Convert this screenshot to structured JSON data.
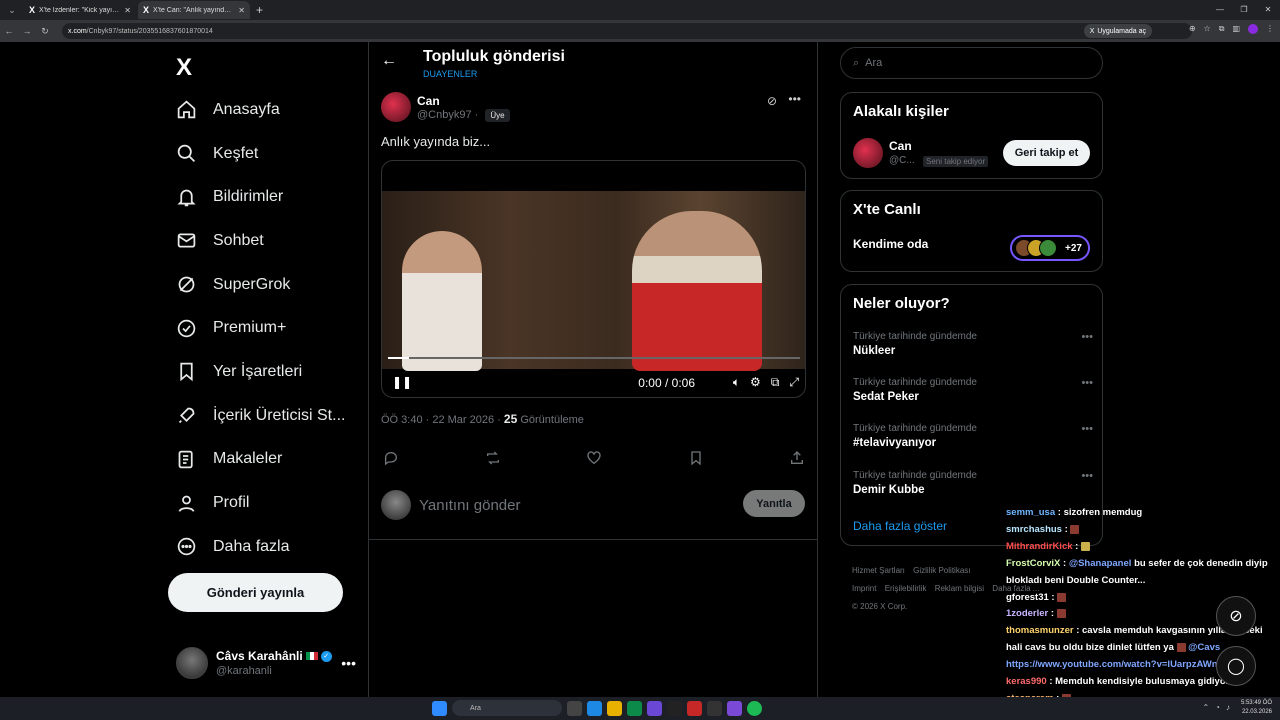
{
  "browser": {
    "tabs": [
      {
        "title": "X'te İzdenler: \"Kick yayıncısı cavs...",
        "active": false
      },
      {
        "title": "X'te Can: \"Anlık yayında biz...\"",
        "active": true
      }
    ],
    "url_domain": "x.com",
    "url_path": "/Cnbyk97/status/2035516837601870014",
    "open_in_app": "Uygulamada aç"
  },
  "sidebar": {
    "logo": "X",
    "items": [
      {
        "label": "Anasayfa",
        "icon": "home-icon"
      },
      {
        "label": "Keşfet",
        "icon": "search-icon"
      },
      {
        "label": "Bildirimler",
        "icon": "bell-icon"
      },
      {
        "label": "Sohbet",
        "icon": "mail-icon"
      },
      {
        "label": "SuperGrok",
        "icon": "grok-icon"
      },
      {
        "label": "Premium+",
        "icon": "verified-icon"
      },
      {
        "label": "Yer İşaretleri",
        "icon": "bookmark-icon"
      },
      {
        "label": "İçerik Üreticisi St...",
        "icon": "rocket-icon"
      },
      {
        "label": "Makaleler",
        "icon": "article-icon"
      },
      {
        "label": "Profil",
        "icon": "person-icon"
      },
      {
        "label": "Daha fazla",
        "icon": "more-circle-icon"
      }
    ],
    "post_button": "Gönderi yayınla",
    "account": {
      "name": "Câvs Karahânli",
      "handle": "@karahanli"
    }
  },
  "main": {
    "title": "Topluluk gönderisi",
    "subtitle": "DUAYENLER",
    "post": {
      "author": "Can",
      "handle": "@Cnbyk97",
      "separator": "·",
      "badge": "Üye",
      "text": "Anlık yayında biz...",
      "video": {
        "time": "0:00 / 0:06",
        "progress": 0.05
      },
      "timestamp": "ÖÖ 3:40 · 22 Mar 2026 ·",
      "views_count": "25",
      "views_label": "Görüntüleme"
    },
    "reply": {
      "placeholder": "Yanıtını gönder",
      "button": "Yanıtla"
    }
  },
  "right": {
    "search_placeholder": "Ara",
    "related": {
      "title": "Alakalı kişiler",
      "name": "Can",
      "handle": "@C...",
      "tag": "Seni takip ediyor",
      "button": "Geri takip et"
    },
    "live": {
      "title": "X'te Canlı",
      "room": "Kendime oda",
      "count": "+27"
    },
    "trends": {
      "title": "Neler oluyor?",
      "items": [
        {
          "context": "Türkiye tarihinde gündemde",
          "topic": "Nükleer"
        },
        {
          "context": "Türkiye tarihinde gündemde",
          "topic": "Sedat Peker"
        },
        {
          "context": "Türkiye tarihinde gündemde",
          "topic": "#telavivyanıyor"
        },
        {
          "context": "Türkiye tarihinde gündemde",
          "topic": "Demir Kubbe"
        }
      ],
      "show_more": "Daha fazla göster"
    },
    "footer": [
      "Hizmet Şartları",
      "Gizlilik Politikası",
      "Imprint",
      "Erişilebilirlik",
      "Reklam bilgisi",
      "Daha fazla ...",
      "© 2026 X Corp."
    ]
  },
  "chat": [
    {
      "user": "semm_usa",
      "color": "#6fb5ff",
      "msg": ": sizofren memdug"
    },
    {
      "user": "smrchashus",
      "color": "#b8e6ff",
      "msg": ":"
    },
    {
      "user": "MithrandirKick",
      "color": "#ff4d4d",
      "msg": ":"
    },
    {
      "user": "FrostCorviX",
      "color": "#d6ffb0",
      "msg": ":",
      "mention": "@Shanapanel",
      "rest": "bu sefer de çok denedin diyip blokladı beni Double Counter..."
    },
    {
      "user": "gforest31",
      "color": "#ffffff",
      "msg": ":"
    },
    {
      "user": "1zoderler",
      "color": "#c9b5ff",
      "msg": ":"
    },
    {
      "user": "thomasmunzer",
      "color": "#ffd36b",
      "msg": ": cavsla memduh kavgasının yıllar önceki hali cavs bu oldu bize dinlet lütfen ya",
      "mention": "@Cavs",
      "link": "https://www.youtube.com/watch?v=lUarpzAWnjI"
    },
    {
      "user": "keras990",
      "color": "#ff6b6b",
      "msg": ": Memduh kendisiyle bulusmaya gidiyor"
    },
    {
      "user": "atesparem",
      "color": "#ffb86b",
      "msg": ":"
    }
  ],
  "taskbar": {
    "search": "Ara",
    "time": "5:53:49 ÖÖ",
    "date": "22.03.2026"
  }
}
